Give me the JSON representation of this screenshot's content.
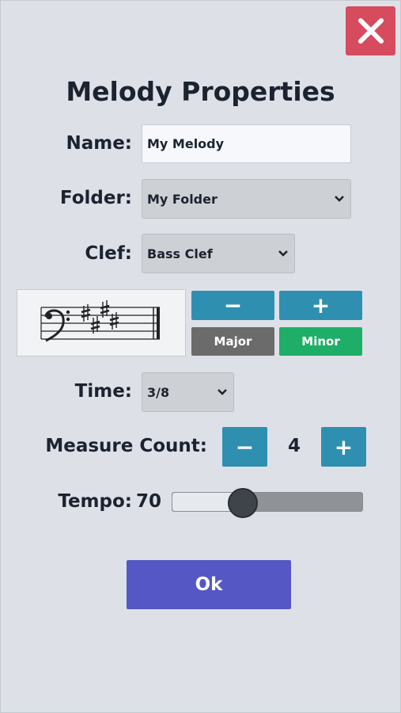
{
  "dialog": {
    "title": "Melody Properties",
    "close_icon": "close-icon"
  },
  "name": {
    "label": "Name:",
    "value": "My Melody"
  },
  "folder": {
    "label": "Folder:",
    "selected": "My Folder"
  },
  "clef": {
    "label": "Clef:",
    "selected": "Bass Clef"
  },
  "key_signature": {
    "decrease_label": "−",
    "increase_label": "+",
    "major_label": "Major",
    "minor_label": "Minor",
    "active_mode": "Minor"
  },
  "time": {
    "label": "Time:",
    "selected": "3/8"
  },
  "measure_count": {
    "label": "Measure Count:",
    "value": "4",
    "decrease_label": "−",
    "increase_label": "+"
  },
  "tempo": {
    "label": "Tempo:",
    "value": "70",
    "level_fraction": 0.37
  },
  "ok_label": "Ok",
  "colors": {
    "background": "#dde1e7",
    "close": "#d64b5e",
    "stepper": "#2f8fb1",
    "major": "#6b6b6b",
    "minor": "#1fae67",
    "ok": "#5457c4",
    "slider_thumb": "#3f444b"
  }
}
